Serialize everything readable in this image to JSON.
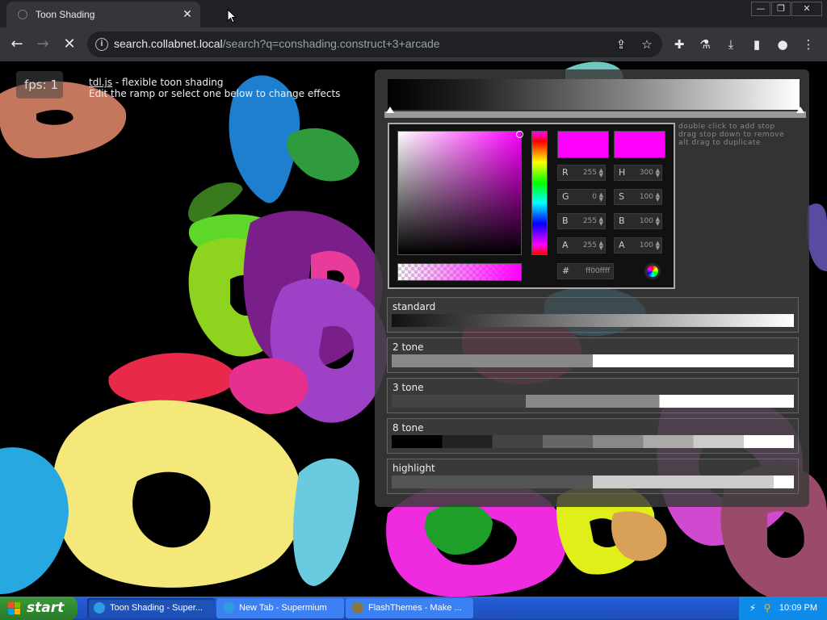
{
  "browser": {
    "tab_title": "Toon Shading",
    "url_host": "search.collabnet.local",
    "url_rest": "/search?q=conshading.construct+3+arcade"
  },
  "page": {
    "fps_label": "fps: 1",
    "lib_name": "tdl.js",
    "lib_desc": " - flexible toon shading",
    "instructions": "Edit the ramp or select one below to change effects",
    "hint": [
      "double click to add stop",
      "drag stop down to remove",
      "alt drag to duplicate"
    ]
  },
  "picker": {
    "color": "#ff00ff",
    "rgba": {
      "R": "255",
      "G": "0",
      "B": "255",
      "A": "255"
    },
    "hsba": {
      "H": "300",
      "S": "100",
      "B": "100",
      "A": "100"
    },
    "hex_label": "#",
    "hex": "ff00ffff"
  },
  "presets": [
    {
      "name": "standard"
    },
    {
      "name": "2 tone"
    },
    {
      "name": "3 tone"
    },
    {
      "name": "8 tone"
    },
    {
      "name": "highlight"
    }
  ],
  "taskbar": {
    "start_label": "start",
    "tasks": [
      {
        "label": "Toon Shading - Super...",
        "icon_color": "#2f9be0"
      },
      {
        "label": "New Tab - Supermium",
        "icon_color": "#2f9be0"
      },
      {
        "label": "FlashThemes - Make ...",
        "icon_color": "#8a7540"
      }
    ],
    "clock": "10:09 PM"
  }
}
